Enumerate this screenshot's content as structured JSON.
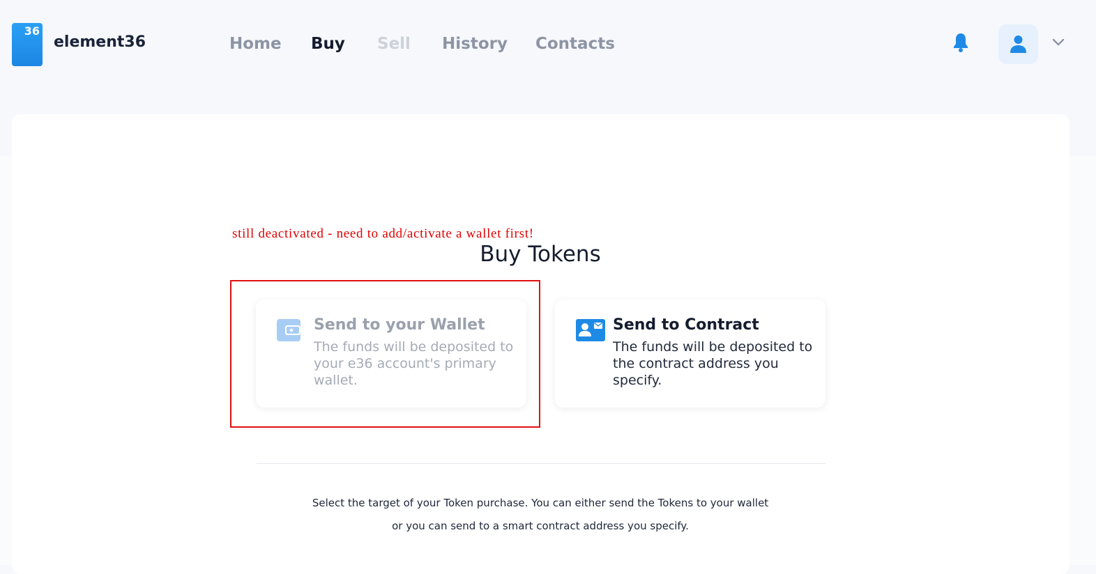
{
  "header": {
    "logo_number": "36",
    "brand": "element36",
    "nav": [
      {
        "label": "Home",
        "state": "normal"
      },
      {
        "label": "Buy",
        "state": "active"
      },
      {
        "label": "Sell",
        "state": "disabled"
      },
      {
        "label": "History",
        "state": "normal"
      },
      {
        "label": "Contacts",
        "state": "normal"
      }
    ],
    "icons": {
      "notifications": "bell-icon",
      "account": "user-icon",
      "menu": "chevron-down-icon"
    }
  },
  "annotation": {
    "note": "still deactivated - need to add/activate a wallet first!",
    "color": "#e00000"
  },
  "main": {
    "title": "Buy Tokens",
    "options": [
      {
        "title": "Send to your Wallet",
        "description": "The funds will be deposited to your e36 account's primary wallet.",
        "icon": "wallet-icon",
        "state": "disabled"
      },
      {
        "title": "Send to Contract",
        "description": "The funds will be deposited to the contract address you specify.",
        "icon": "contact-card-icon",
        "state": "enabled"
      }
    ],
    "info_line_1": "Select the target of your Token purchase. You can either send the Tokens to your wallet",
    "info_line_2": "or you can send to a smart contract address you specify."
  },
  "colors": {
    "accent": "#1f8ae6",
    "text_dark": "#141c2e",
    "text_muted": "#8d94a3",
    "background": "#f6f8fb"
  }
}
